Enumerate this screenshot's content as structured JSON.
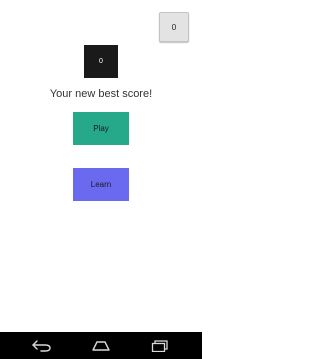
{
  "header": {
    "counter_value": "0"
  },
  "score": {
    "value": "0",
    "message": "Your new best score!"
  },
  "actions": {
    "play_label": "Play",
    "learn_label": "Learn"
  },
  "nav": {
    "back_icon": "back-arrow-icon",
    "home_icon": "home-icon",
    "recents_icon": "recent-apps-icon"
  },
  "colors": {
    "play": "#26a98b",
    "learn": "#6a6af0",
    "score_box": "#1a1a1a",
    "nav_bar": "#000000"
  }
}
